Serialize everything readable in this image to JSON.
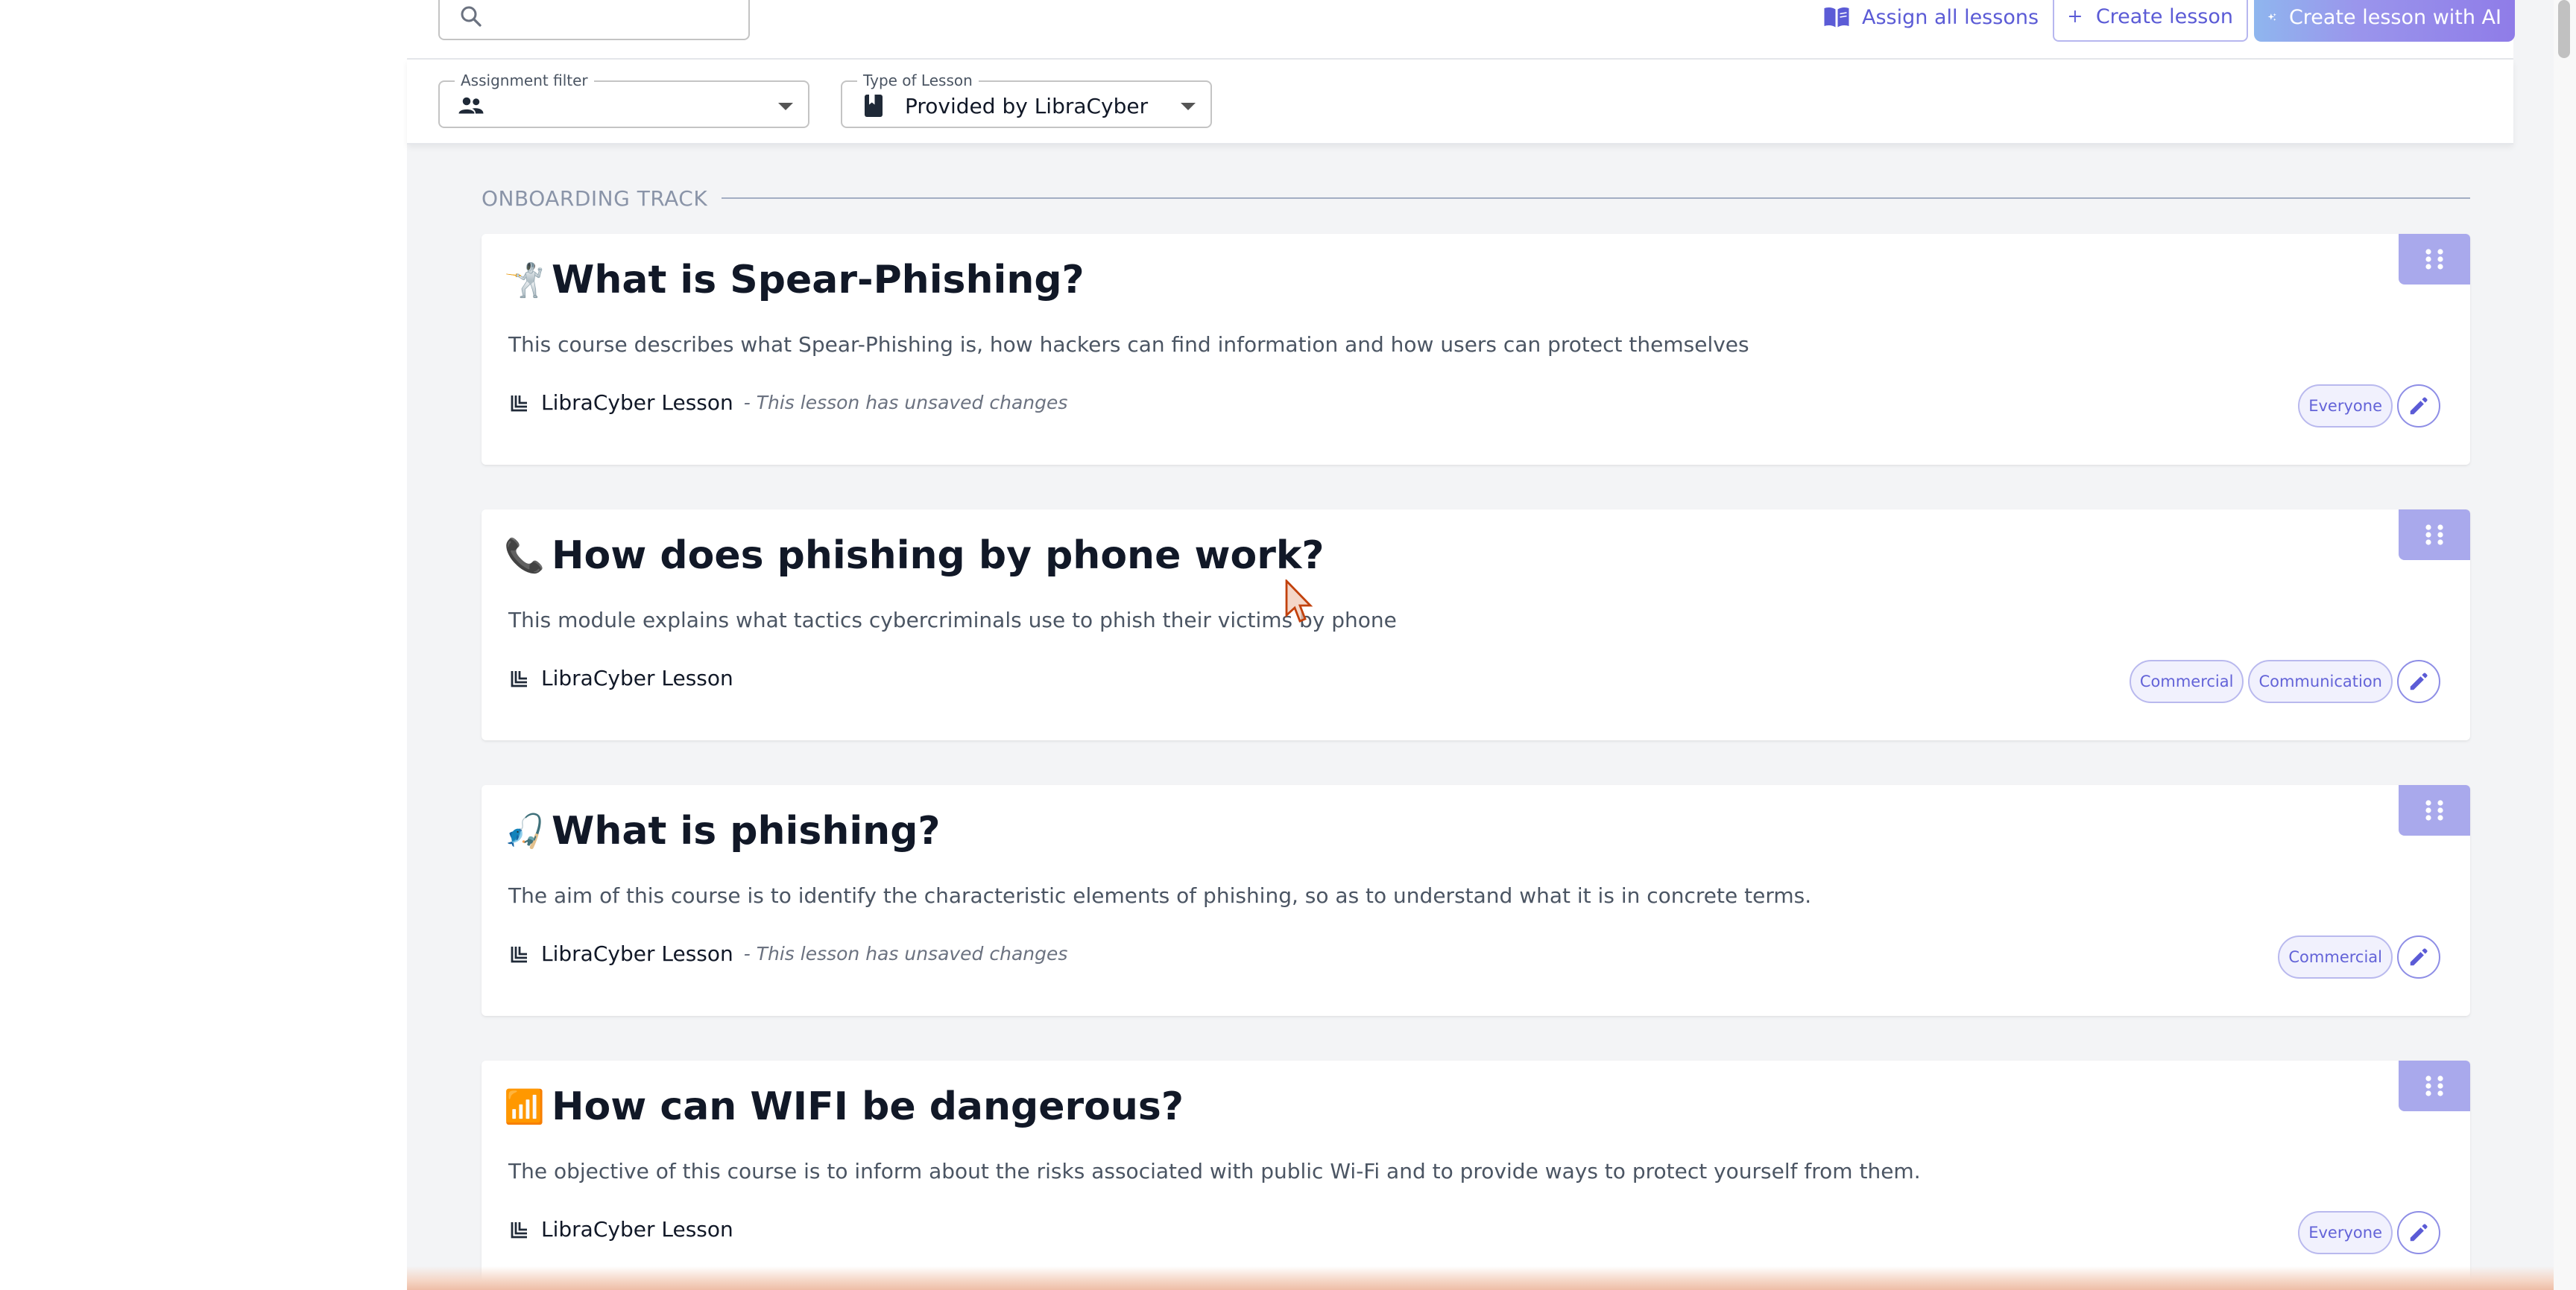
{
  "toolbar": {
    "search_placeholder": "",
    "assign_all_label": "Assign all lessons",
    "create_lesson_label": "Create lesson",
    "create_ai_label": "Create lesson with AI"
  },
  "filters": {
    "assignment": {
      "label": "Assignment filter",
      "value": ""
    },
    "type": {
      "label": "Type of Lesson",
      "value": "Provided by LibraCyber"
    }
  },
  "section": {
    "title": "ONBOARDING TRACK"
  },
  "lessons": [
    {
      "emoji": "🤺",
      "title": "What is Spear-Phishing?",
      "description": "This course describes what Spear-Phishing is, how hackers can find information and how users can protect themselves",
      "source": "LibraCyber Lesson",
      "note": "- This lesson has unsaved changes",
      "tags": [
        "Everyone"
      ]
    },
    {
      "emoji": "📞",
      "title": "How does phishing by phone work?",
      "description": "This module explains what tactics cybercriminals use to phish their victims by phone",
      "source": "LibraCyber Lesson",
      "note": "",
      "tags": [
        "Commercial",
        "Communication"
      ]
    },
    {
      "emoji": "🎣",
      "title": "What is phishing?",
      "description": "The aim of this course is to identify the characteristic elements of phishing, so as to understand what it is in concrete terms.",
      "source": "LibraCyber Lesson",
      "note": "- This lesson has unsaved changes",
      "tags": [
        "Commercial"
      ]
    },
    {
      "emoji": "📶",
      "title": "How can WIFI be dangerous?",
      "description": "The objective of this course is to inform about the risks associated with public Wi-Fi and to provide ways to protect yourself from them.",
      "source": "LibraCyber Lesson",
      "note": "",
      "tags": [
        "Everyone"
      ]
    }
  ],
  "icons": {
    "search": "search-icon",
    "assign": "book-icon",
    "create": "plus-icon",
    "ai": "sparkle-icon",
    "group": "group-icon",
    "lesson_type": "bookmark-book-icon",
    "drag": "drag-handle-icon",
    "source": "libracyber-logo-icon",
    "edit": "pencil-icon"
  },
  "colors": {
    "accent": "#5b5bd6",
    "drag_handle": "#a9a9ec",
    "tag_border": "#b9b9ee",
    "background": "#f3f4f6"
  }
}
